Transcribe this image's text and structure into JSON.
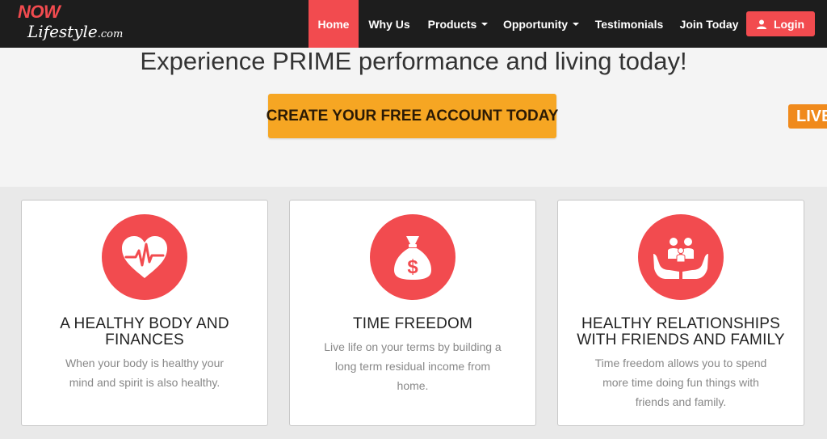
{
  "brand": {
    "logo_top": "NOW",
    "logo_main": "Lifestyle",
    "logo_suffix": ".com"
  },
  "nav": {
    "items": [
      {
        "label": "Home",
        "active": true
      },
      {
        "label": "Why Us",
        "active": false
      },
      {
        "label": "Products",
        "active": false,
        "dropdown": true
      },
      {
        "label": "Opportunity",
        "active": false,
        "dropdown": true
      },
      {
        "label": "Testimonials",
        "active": false
      },
      {
        "label": "Join Today",
        "active": false
      }
    ],
    "login_label": "Login",
    "login_icon": "user-icon"
  },
  "hero": {
    "headline": "Experience PRIME performance and living today!",
    "cta_label": "CREATE YOUR FREE ACCOUNT TODAY",
    "live_tab": "LIVE"
  },
  "cards": [
    {
      "icon": "heart-pulse-icon",
      "title_line1": "A HEALTHY BODY AND",
      "title_line2": "FINANCES",
      "desc_lines": [
        "When your body is healthy your",
        "mind and spirit is also healthy."
      ]
    },
    {
      "icon": "money-bag-icon",
      "title_line1": "TIME FREEDOM",
      "title_line2": "",
      "desc_lines": [
        "Live life on your terms by building a",
        "long term residual income from",
        "home."
      ]
    },
    {
      "icon": "family-hands-icon",
      "title_line1": "HEALTHY RELATIONSHIPS",
      "title_line2": "WITH FRIENDS AND FAMILY",
      "desc_lines": [
        "Time freedom allows you to spend",
        "more time doing fun things with",
        "friends and family."
      ]
    }
  ],
  "colors": {
    "accent": "#f24b4f",
    "cta": "#f6a623",
    "live": "#f08a1c",
    "navbar": "#1d1d1d"
  }
}
